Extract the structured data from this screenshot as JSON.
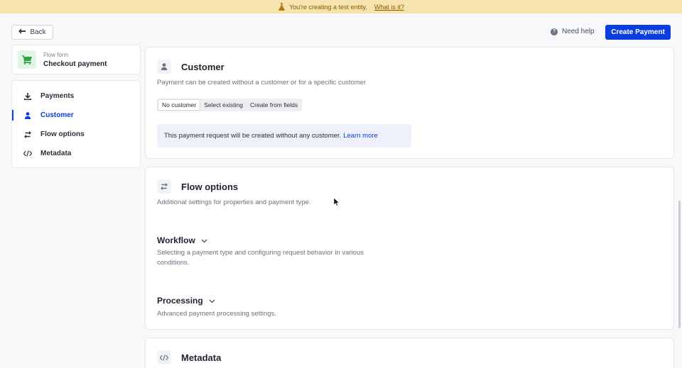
{
  "banner": {
    "message": "You're creating a test entity.",
    "link": "What is it?"
  },
  "topbar": {
    "back_label": "Back",
    "help_label": "Need help",
    "create_label": "Create Payment"
  },
  "flow": {
    "kind_label": "Flow form",
    "name": "Checkout payment"
  },
  "nav": {
    "items": [
      {
        "label": "Payments",
        "icon": "download-icon"
      },
      {
        "label": "Customer",
        "icon": "person-icon",
        "active": true
      },
      {
        "label": "Flow options",
        "icon": "swap-icon"
      },
      {
        "label": "Metadata",
        "icon": "code-icon"
      }
    ]
  },
  "customer": {
    "title": "Customer",
    "description": "Payment can be created without a customer or for a specific customer",
    "options": [
      "No customer",
      "Select existing",
      "Create from fields"
    ],
    "selected": "No customer",
    "notice_text": "This payment request will be created without any customer.",
    "notice_link": "Learn more"
  },
  "flow_options": {
    "title": "Flow options",
    "description": "Additional settings for properties and payment type.",
    "workflow": {
      "title": "Workflow",
      "description": "Selecting a payment type and configuring request behavior in various conditions."
    },
    "processing": {
      "title": "Processing",
      "description": "Advanced payment processing settings."
    }
  },
  "metadata": {
    "title": "Metadata"
  },
  "colors": {
    "accent": "#0b3de0",
    "banner_bg": "#f7e3b0",
    "cart_green": "#2fa34a"
  }
}
